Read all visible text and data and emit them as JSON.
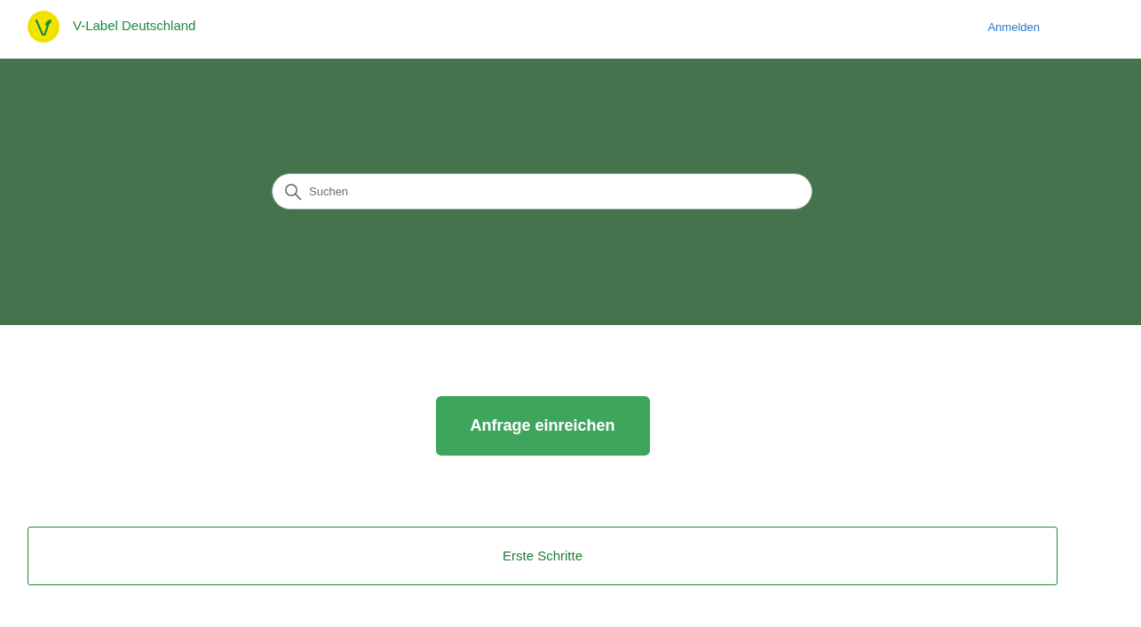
{
  "header": {
    "brand": "V-Label Deutschland",
    "sign_in": "Anmelden"
  },
  "hero": {
    "search": {
      "placeholder": "Suchen"
    }
  },
  "primary_action": "Anfrage einreichen",
  "sections": [
    {
      "title": "Erste Schritte"
    }
  ]
}
